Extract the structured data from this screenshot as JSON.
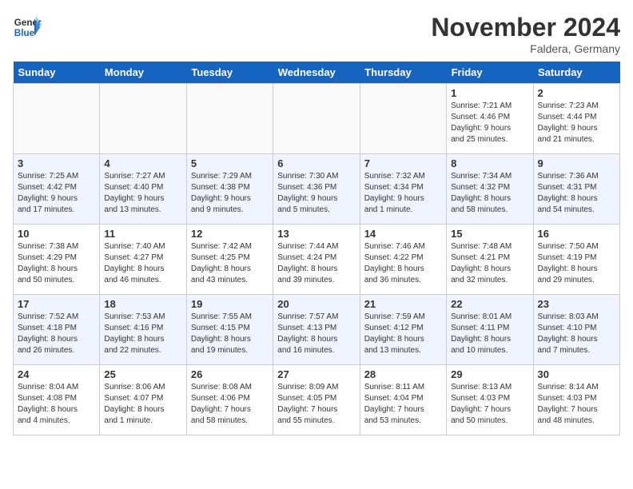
{
  "header": {
    "logo_general": "General",
    "logo_blue": "Blue",
    "month_title": "November 2024",
    "location": "Faldera, Germany"
  },
  "days_of_week": [
    "Sunday",
    "Monday",
    "Tuesday",
    "Wednesday",
    "Thursday",
    "Friday",
    "Saturday"
  ],
  "weeks": [
    [
      {
        "day": "",
        "info": ""
      },
      {
        "day": "",
        "info": ""
      },
      {
        "day": "",
        "info": ""
      },
      {
        "day": "",
        "info": ""
      },
      {
        "day": "",
        "info": ""
      },
      {
        "day": "1",
        "info": "Sunrise: 7:21 AM\nSunset: 4:46 PM\nDaylight: 9 hours\nand 25 minutes."
      },
      {
        "day": "2",
        "info": "Sunrise: 7:23 AM\nSunset: 4:44 PM\nDaylight: 9 hours\nand 21 minutes."
      }
    ],
    [
      {
        "day": "3",
        "info": "Sunrise: 7:25 AM\nSunset: 4:42 PM\nDaylight: 9 hours\nand 17 minutes."
      },
      {
        "day": "4",
        "info": "Sunrise: 7:27 AM\nSunset: 4:40 PM\nDaylight: 9 hours\nand 13 minutes."
      },
      {
        "day": "5",
        "info": "Sunrise: 7:29 AM\nSunset: 4:38 PM\nDaylight: 9 hours\nand 9 minutes."
      },
      {
        "day": "6",
        "info": "Sunrise: 7:30 AM\nSunset: 4:36 PM\nDaylight: 9 hours\nand 5 minutes."
      },
      {
        "day": "7",
        "info": "Sunrise: 7:32 AM\nSunset: 4:34 PM\nDaylight: 9 hours\nand 1 minute."
      },
      {
        "day": "8",
        "info": "Sunrise: 7:34 AM\nSunset: 4:32 PM\nDaylight: 8 hours\nand 58 minutes."
      },
      {
        "day": "9",
        "info": "Sunrise: 7:36 AM\nSunset: 4:31 PM\nDaylight: 8 hours\nand 54 minutes."
      }
    ],
    [
      {
        "day": "10",
        "info": "Sunrise: 7:38 AM\nSunset: 4:29 PM\nDaylight: 8 hours\nand 50 minutes."
      },
      {
        "day": "11",
        "info": "Sunrise: 7:40 AM\nSunset: 4:27 PM\nDaylight: 8 hours\nand 46 minutes."
      },
      {
        "day": "12",
        "info": "Sunrise: 7:42 AM\nSunset: 4:25 PM\nDaylight: 8 hours\nand 43 minutes."
      },
      {
        "day": "13",
        "info": "Sunrise: 7:44 AM\nSunset: 4:24 PM\nDaylight: 8 hours\nand 39 minutes."
      },
      {
        "day": "14",
        "info": "Sunrise: 7:46 AM\nSunset: 4:22 PM\nDaylight: 8 hours\nand 36 minutes."
      },
      {
        "day": "15",
        "info": "Sunrise: 7:48 AM\nSunset: 4:21 PM\nDaylight: 8 hours\nand 32 minutes."
      },
      {
        "day": "16",
        "info": "Sunrise: 7:50 AM\nSunset: 4:19 PM\nDaylight: 8 hours\nand 29 minutes."
      }
    ],
    [
      {
        "day": "17",
        "info": "Sunrise: 7:52 AM\nSunset: 4:18 PM\nDaylight: 8 hours\nand 26 minutes."
      },
      {
        "day": "18",
        "info": "Sunrise: 7:53 AM\nSunset: 4:16 PM\nDaylight: 8 hours\nand 22 minutes."
      },
      {
        "day": "19",
        "info": "Sunrise: 7:55 AM\nSunset: 4:15 PM\nDaylight: 8 hours\nand 19 minutes."
      },
      {
        "day": "20",
        "info": "Sunrise: 7:57 AM\nSunset: 4:13 PM\nDaylight: 8 hours\nand 16 minutes."
      },
      {
        "day": "21",
        "info": "Sunrise: 7:59 AM\nSunset: 4:12 PM\nDaylight: 8 hours\nand 13 minutes."
      },
      {
        "day": "22",
        "info": "Sunrise: 8:01 AM\nSunset: 4:11 PM\nDaylight: 8 hours\nand 10 minutes."
      },
      {
        "day": "23",
        "info": "Sunrise: 8:03 AM\nSunset: 4:10 PM\nDaylight: 8 hours\nand 7 minutes."
      }
    ],
    [
      {
        "day": "24",
        "info": "Sunrise: 8:04 AM\nSunset: 4:08 PM\nDaylight: 8 hours\nand 4 minutes."
      },
      {
        "day": "25",
        "info": "Sunrise: 8:06 AM\nSunset: 4:07 PM\nDaylight: 8 hours\nand 1 minute."
      },
      {
        "day": "26",
        "info": "Sunrise: 8:08 AM\nSunset: 4:06 PM\nDaylight: 7 hours\nand 58 minutes."
      },
      {
        "day": "27",
        "info": "Sunrise: 8:09 AM\nSunset: 4:05 PM\nDaylight: 7 hours\nand 55 minutes."
      },
      {
        "day": "28",
        "info": "Sunrise: 8:11 AM\nSunset: 4:04 PM\nDaylight: 7 hours\nand 53 minutes."
      },
      {
        "day": "29",
        "info": "Sunrise: 8:13 AM\nSunset: 4:03 PM\nDaylight: 7 hours\nand 50 minutes."
      },
      {
        "day": "30",
        "info": "Sunrise: 8:14 AM\nSunset: 4:03 PM\nDaylight: 7 hours\nand 48 minutes."
      }
    ]
  ]
}
